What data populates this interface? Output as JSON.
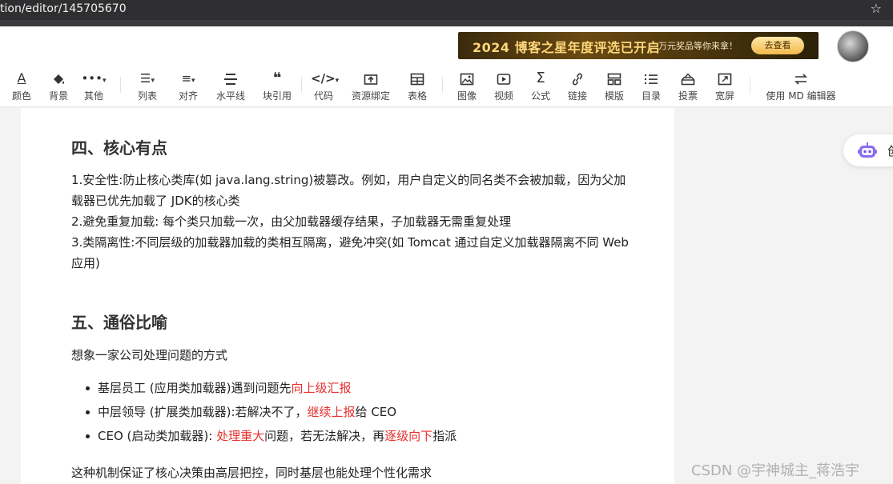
{
  "browser": {
    "url": "tion/editor/145705670",
    "bookmark_icon": "star-icon"
  },
  "header": {
    "banner_main": "2024 博客之星年度评选已开启",
    "banner_sub": "万元奖品等你来拿！",
    "banner_button": "去查看"
  },
  "toolbar": {
    "items": [
      {
        "label": "颜色",
        "icon": "font-color-icon"
      },
      {
        "label": "背景",
        "icon": "paint-bucket-icon"
      },
      {
        "label": "其他",
        "icon": "more-icon"
      },
      {
        "label": "列表",
        "icon": "list-icon"
      },
      {
        "label": "对齐",
        "icon": "align-icon"
      },
      {
        "label": "水平线",
        "icon": "horizontal-rule-icon"
      },
      {
        "label": "块引用",
        "icon": "quote-icon"
      },
      {
        "label": "代码",
        "icon": "code-icon"
      },
      {
        "label": "资源绑定",
        "icon": "resource-upload-icon"
      },
      {
        "label": "表格",
        "icon": "table-icon"
      },
      {
        "label": "图像",
        "icon": "image-icon"
      },
      {
        "label": "视频",
        "icon": "video-icon"
      },
      {
        "label": "公式",
        "icon": "sigma-icon"
      },
      {
        "label": "链接",
        "icon": "link-icon"
      },
      {
        "label": "模版",
        "icon": "template-icon"
      },
      {
        "label": "目录",
        "icon": "toc-icon"
      },
      {
        "label": "投票",
        "icon": "vote-icon"
      },
      {
        "label": "宽屏",
        "icon": "widescreen-icon"
      },
      {
        "label": "使用 MD 编辑器",
        "icon": "switch-icon"
      }
    ]
  },
  "content": {
    "section4_title": "四、核心有点",
    "section4_p1": "1.安全性:防止核心类库(如 java.lang.string)被篡改。例如，用户自定义的同名类不会被加载，因为父加载器已优先加载了 JDK的核心类",
    "section4_p2": "2.避免重复加载: 每个类只加载一次，由父加载器缓存结果，子加载器无需重复处理",
    "section4_p3": "3.类隔离性:不同层级的加载器加载的类相互隔离，避免冲突(如 Tomcat 通过自定义加载器隔离不同 Web 应用)",
    "section5_title": "五、通俗比喻",
    "section5_intro": "想象一家公司处理问题的方式",
    "bullets": [
      {
        "a": "基层员工 (应用类加载器)遇到问题先",
        "b": "向上级汇报",
        "c": ""
      },
      {
        "a": "中层领导 (扩展类加载器):若解决不了，",
        "b": "继续上报",
        "c": "给 CEO"
      },
      {
        "a": "CEO (启动类加载器): ",
        "b": "处理重大",
        "c": "问题，若无法解决，再",
        "d": "逐级向下",
        "e": "指派"
      }
    ],
    "conclusion": "这种机制保证了核心决策由高层把控，同时基层也能处理个性化需求"
  },
  "assistant": {
    "label": "创"
  },
  "watermark": "CSDN @宇神城主_蒋浩宇",
  "colors": {
    "highlight_red": "#e7302d"
  }
}
